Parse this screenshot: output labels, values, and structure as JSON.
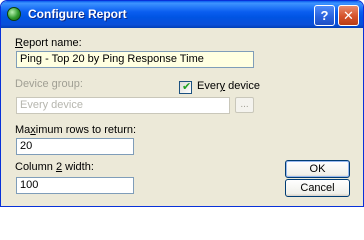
{
  "window": {
    "title": "Configure Report",
    "help_label": "?",
    "close_label": "✕"
  },
  "form": {
    "report_name": {
      "label_accel": "R",
      "label_rest": "eport name:",
      "value": "Ping - Top 20 by Ping Response Time"
    },
    "device_group": {
      "label": "Device group:",
      "value": "Every device",
      "browse_label": "..."
    },
    "every_device": {
      "label_pre": "Ever",
      "label_accel": "y",
      "label_post": " device",
      "checked": true
    },
    "max_rows": {
      "label_pre": "Ma",
      "label_accel": "x",
      "label_post": "imum rows to return:",
      "value": "20"
    },
    "column2_width": {
      "label_pre": "Column ",
      "label_accel": "2",
      "label_post": " width:",
      "value": "100"
    }
  },
  "buttons": {
    "ok": "OK",
    "cancel": "Cancel"
  },
  "colors": {
    "titlebar": "#0054e3",
    "dialog_bg": "#ece9d8",
    "highlight_field": "#ffffe1",
    "checkmark": "#21a121"
  }
}
